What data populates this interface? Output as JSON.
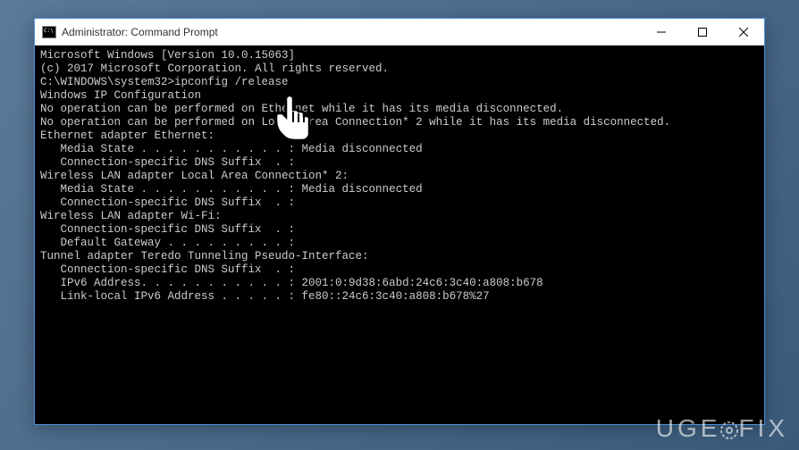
{
  "titlebar": {
    "title": "Administrator: Command Prompt"
  },
  "terminal": {
    "lines": [
      "Microsoft Windows [Version 10.0.15063]",
      "(c) 2017 Microsoft Corporation. All rights reserved.",
      "",
      "C:\\WINDOWS\\system32>ipconfig /release",
      "",
      "Windows IP Configuration",
      "",
      "No operation can be performed on Ethernet while it has its media disconnected.",
      "No operation can be performed on Local Area Connection* 2 while it has its media disconnected.",
      "",
      "Ethernet adapter Ethernet:",
      "",
      "   Media State . . . . . . . . . . . : Media disconnected",
      "   Connection-specific DNS Suffix  . :",
      "",
      "Wireless LAN adapter Local Area Connection* 2:",
      "",
      "   Media State . . . . . . . . . . . : Media disconnected",
      "   Connection-specific DNS Suffix  . :",
      "",
      "Wireless LAN adapter Wi-Fi:",
      "",
      "   Connection-specific DNS Suffix  . :",
      "   Default Gateway . . . . . . . . . :",
      "",
      "Tunnel adapter Teredo Tunneling Pseudo-Interface:",
      "",
      "   Connection-specific DNS Suffix  . :",
      "   IPv6 Address. . . . . . . . . . . : 2001:0:9d38:6abd:24c6:3c40:a808:b678",
      "   Link-local IPv6 Address . . . . . : fe80::24c6:3c40:a808:b678%27"
    ]
  },
  "watermark": {
    "text_before": "UGE",
    "text_after": "FIX"
  }
}
